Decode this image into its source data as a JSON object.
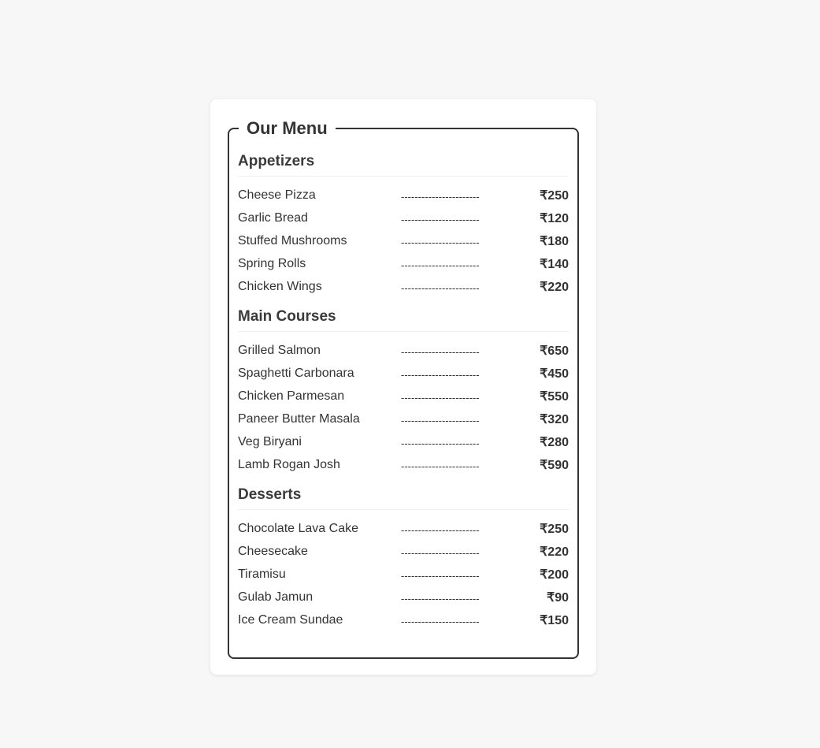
{
  "menu": {
    "title": "Our Menu",
    "sections": [
      {
        "title": "Appetizers",
        "items": [
          {
            "name": "Cheese Pizza",
            "dots": "-----------------------",
            "price": "₹250"
          },
          {
            "name": "Garlic Bread",
            "dots": "-----------------------",
            "price": "₹120"
          },
          {
            "name": "Stuffed Mushrooms",
            "dots": "-----------------------",
            "price": "₹180"
          },
          {
            "name": "Spring Rolls",
            "dots": "-----------------------",
            "price": "₹140"
          },
          {
            "name": "Chicken Wings",
            "dots": "-----------------------",
            "price": "₹220"
          }
        ]
      },
      {
        "title": "Main Courses",
        "items": [
          {
            "name": "Grilled Salmon",
            "dots": "-----------------------",
            "price": "₹650"
          },
          {
            "name": "Spaghetti Carbonara",
            "dots": "-----------------------",
            "price": "₹450"
          },
          {
            "name": "Chicken Parmesan",
            "dots": "-----------------------",
            "price": "₹550"
          },
          {
            "name": "Paneer Butter Masala",
            "dots": "-----------------------",
            "price": "₹320"
          },
          {
            "name": "Veg Biryani",
            "dots": "-----------------------",
            "price": "₹280"
          },
          {
            "name": "Lamb Rogan Josh",
            "dots": "-----------------------",
            "price": "₹590"
          }
        ]
      },
      {
        "title": "Desserts",
        "items": [
          {
            "name": "Chocolate Lava Cake",
            "dots": "-----------------------",
            "price": "₹250"
          },
          {
            "name": "Cheesecake",
            "dots": "-----------------------",
            "price": "₹220"
          },
          {
            "name": "Tiramisu",
            "dots": "-----------------------",
            "price": "₹200"
          },
          {
            "name": "Gulab Jamun",
            "dots": "-----------------------",
            "price": "₹90"
          },
          {
            "name": "Ice Cream Sundae",
            "dots": "-----------------------",
            "price": "₹150"
          }
        ]
      }
    ]
  }
}
